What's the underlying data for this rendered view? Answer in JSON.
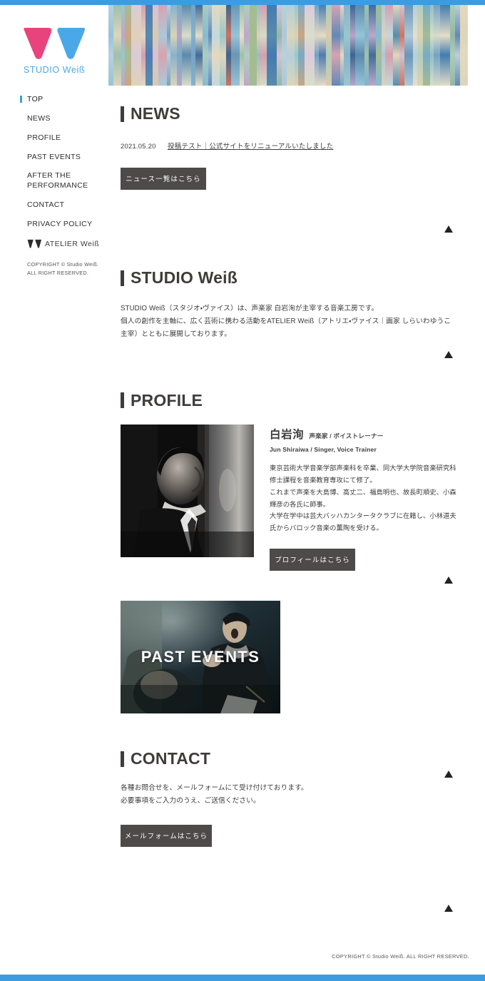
{
  "theme": {
    "accent_blue": "#3d9ce0",
    "logo_pink": "#e8437c",
    "logo_blue": "#4aa8e8",
    "heading_dark": "#403c3c",
    "button_bg": "#4d4a49"
  },
  "sidebar": {
    "logo": {
      "mark_name": "studio-weiss-w-logo",
      "text": "STUDIO Weiß"
    },
    "items": [
      {
        "label": "TOP",
        "active": true
      },
      {
        "label": "NEWS",
        "active": false
      },
      {
        "label": "PROFILE",
        "active": false
      },
      {
        "label": "PAST EVENTS",
        "active": false
      },
      {
        "label": "AFTER THE PERFORMANCE",
        "active": false
      },
      {
        "label": "CONTACT",
        "active": false
      },
      {
        "label": "PRIVACY POLICY",
        "active": false
      }
    ],
    "atelier": {
      "mark_name": "atelier-weiss-w-logo",
      "label": "ATELIER Weiß"
    },
    "copyright_line1": "COPYRIGHT © Studio Weiß.",
    "copyright_line2": "ALL RIGHT RESERVED."
  },
  "hero": {
    "alt": "abstract vertical paper strip collage banner"
  },
  "sections": {
    "news": {
      "heading": "NEWS",
      "entry": {
        "date": "2021.05.20",
        "link_text": "投稿テスト｜公式サイトをリニューアルいたしました"
      },
      "button_label": "ニュース一覧はこちら"
    },
    "studio": {
      "heading": "STUDIO Weiß",
      "paragraph": "STUDIO Weiß（スタジオ・ヴァイス）は、声楽家 白岩洵が主宰する音楽工房です。\n個人の創作を主軸に、広く芸術に携わる活動をATELIER Weiß（アトリエ・ヴァイス｜画家 しらいわゆうこ主宰）とともに展開しております。"
    },
    "profile": {
      "heading": "PROFILE",
      "portrait_alt": "monochrome portrait of Jun Shiraiwa in profile",
      "name_ja": "白岩洵",
      "role_ja": "声楽家 / ボイストレーナー",
      "name_en": "Jun Shiraiwa / Singer, Voice Trainer",
      "bio": "東京芸術大学音楽学部声楽科を卒業、同大学大学院音楽研究科修士課程を音楽教育専攻にて修了。\nこれまで声楽を大島博、高丈二、福島明也、故長町順史、小森輝彦の各氏に師事。\n大学在学中は芸大バッハカンタータクラブに在籍し、小林道夫氏からバロック音楽の薫陶を受ける。",
      "button_label": "プロフィールはこちら"
    },
    "past_events": {
      "banner_label": "PAST EVENTS",
      "banner_alt": "conductor singing in front of dark stage"
    },
    "contact": {
      "heading": "CONTACT",
      "paragraph": "各種お問合せを、メールフォームにて受け付けております。\n必要事項をご入力のうえ、ご送信ください。",
      "button_label": "メールフォームはこちら"
    }
  },
  "to_top": {
    "icon_name": "scroll-to-top-triangle",
    "count": 5
  },
  "footer": {
    "copyright": "COPYRIGHT © Studio Weiß. ALL RIGHT RESERVED."
  }
}
